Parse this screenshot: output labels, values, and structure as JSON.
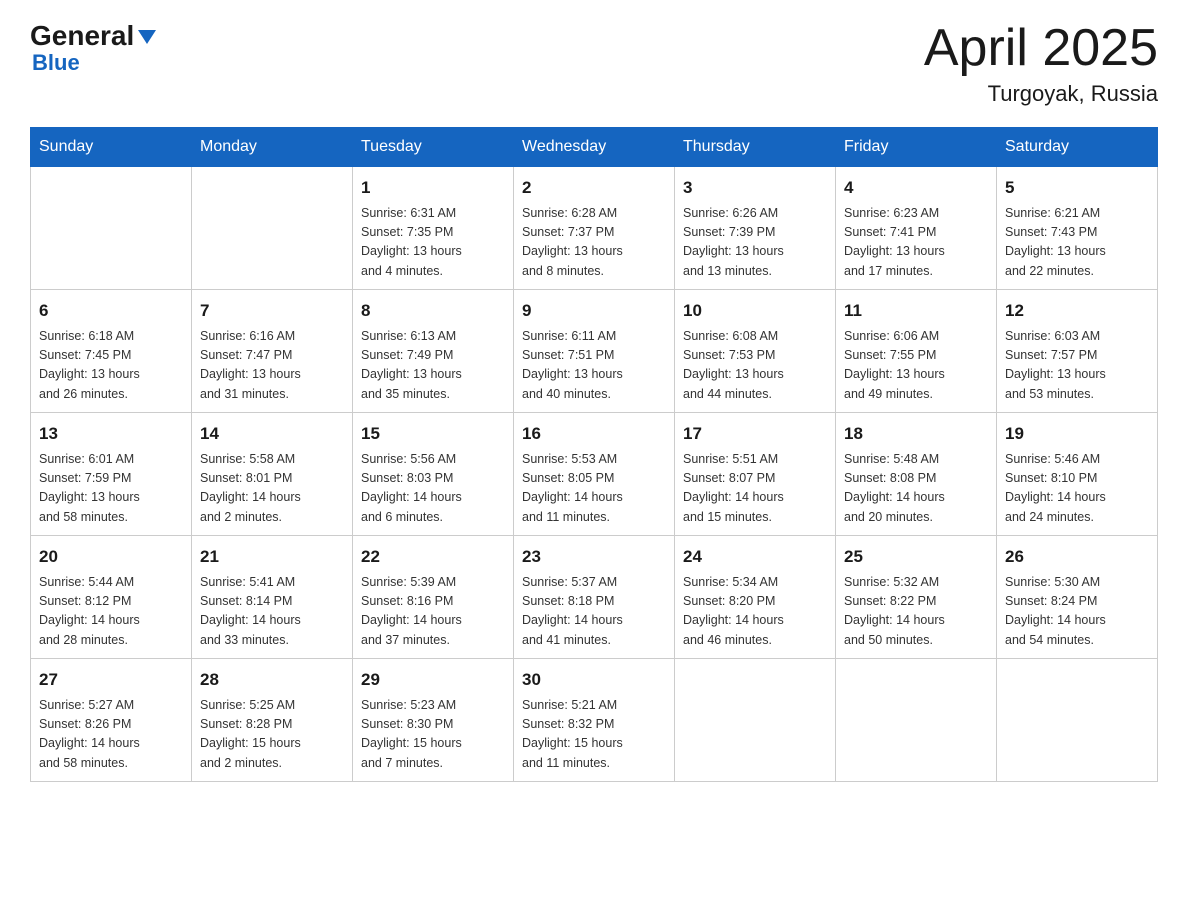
{
  "header": {
    "logo": {
      "general": "General",
      "arrow_symbol": "▶",
      "blue": "Blue"
    },
    "title": "April 2025",
    "location": "Turgoyak, Russia"
  },
  "calendar": {
    "days_of_week": [
      "Sunday",
      "Monday",
      "Tuesday",
      "Wednesday",
      "Thursday",
      "Friday",
      "Saturday"
    ],
    "weeks": [
      [
        {
          "day": "",
          "info": ""
        },
        {
          "day": "",
          "info": ""
        },
        {
          "day": "1",
          "info": "Sunrise: 6:31 AM\nSunset: 7:35 PM\nDaylight: 13 hours\nand 4 minutes."
        },
        {
          "day": "2",
          "info": "Sunrise: 6:28 AM\nSunset: 7:37 PM\nDaylight: 13 hours\nand 8 minutes."
        },
        {
          "day": "3",
          "info": "Sunrise: 6:26 AM\nSunset: 7:39 PM\nDaylight: 13 hours\nand 13 minutes."
        },
        {
          "day": "4",
          "info": "Sunrise: 6:23 AM\nSunset: 7:41 PM\nDaylight: 13 hours\nand 17 minutes."
        },
        {
          "day": "5",
          "info": "Sunrise: 6:21 AM\nSunset: 7:43 PM\nDaylight: 13 hours\nand 22 minutes."
        }
      ],
      [
        {
          "day": "6",
          "info": "Sunrise: 6:18 AM\nSunset: 7:45 PM\nDaylight: 13 hours\nand 26 minutes."
        },
        {
          "day": "7",
          "info": "Sunrise: 6:16 AM\nSunset: 7:47 PM\nDaylight: 13 hours\nand 31 minutes."
        },
        {
          "day": "8",
          "info": "Sunrise: 6:13 AM\nSunset: 7:49 PM\nDaylight: 13 hours\nand 35 minutes."
        },
        {
          "day": "9",
          "info": "Sunrise: 6:11 AM\nSunset: 7:51 PM\nDaylight: 13 hours\nand 40 minutes."
        },
        {
          "day": "10",
          "info": "Sunrise: 6:08 AM\nSunset: 7:53 PM\nDaylight: 13 hours\nand 44 minutes."
        },
        {
          "day": "11",
          "info": "Sunrise: 6:06 AM\nSunset: 7:55 PM\nDaylight: 13 hours\nand 49 minutes."
        },
        {
          "day": "12",
          "info": "Sunrise: 6:03 AM\nSunset: 7:57 PM\nDaylight: 13 hours\nand 53 minutes."
        }
      ],
      [
        {
          "day": "13",
          "info": "Sunrise: 6:01 AM\nSunset: 7:59 PM\nDaylight: 13 hours\nand 58 minutes."
        },
        {
          "day": "14",
          "info": "Sunrise: 5:58 AM\nSunset: 8:01 PM\nDaylight: 14 hours\nand 2 minutes."
        },
        {
          "day": "15",
          "info": "Sunrise: 5:56 AM\nSunset: 8:03 PM\nDaylight: 14 hours\nand 6 minutes."
        },
        {
          "day": "16",
          "info": "Sunrise: 5:53 AM\nSunset: 8:05 PM\nDaylight: 14 hours\nand 11 minutes."
        },
        {
          "day": "17",
          "info": "Sunrise: 5:51 AM\nSunset: 8:07 PM\nDaylight: 14 hours\nand 15 minutes."
        },
        {
          "day": "18",
          "info": "Sunrise: 5:48 AM\nSunset: 8:08 PM\nDaylight: 14 hours\nand 20 minutes."
        },
        {
          "day": "19",
          "info": "Sunrise: 5:46 AM\nSunset: 8:10 PM\nDaylight: 14 hours\nand 24 minutes."
        }
      ],
      [
        {
          "day": "20",
          "info": "Sunrise: 5:44 AM\nSunset: 8:12 PM\nDaylight: 14 hours\nand 28 minutes."
        },
        {
          "day": "21",
          "info": "Sunrise: 5:41 AM\nSunset: 8:14 PM\nDaylight: 14 hours\nand 33 minutes."
        },
        {
          "day": "22",
          "info": "Sunrise: 5:39 AM\nSunset: 8:16 PM\nDaylight: 14 hours\nand 37 minutes."
        },
        {
          "day": "23",
          "info": "Sunrise: 5:37 AM\nSunset: 8:18 PM\nDaylight: 14 hours\nand 41 minutes."
        },
        {
          "day": "24",
          "info": "Sunrise: 5:34 AM\nSunset: 8:20 PM\nDaylight: 14 hours\nand 46 minutes."
        },
        {
          "day": "25",
          "info": "Sunrise: 5:32 AM\nSunset: 8:22 PM\nDaylight: 14 hours\nand 50 minutes."
        },
        {
          "day": "26",
          "info": "Sunrise: 5:30 AM\nSunset: 8:24 PM\nDaylight: 14 hours\nand 54 minutes."
        }
      ],
      [
        {
          "day": "27",
          "info": "Sunrise: 5:27 AM\nSunset: 8:26 PM\nDaylight: 14 hours\nand 58 minutes."
        },
        {
          "day": "28",
          "info": "Sunrise: 5:25 AM\nSunset: 8:28 PM\nDaylight: 15 hours\nand 2 minutes."
        },
        {
          "day": "29",
          "info": "Sunrise: 5:23 AM\nSunset: 8:30 PM\nDaylight: 15 hours\nand 7 minutes."
        },
        {
          "day": "30",
          "info": "Sunrise: 5:21 AM\nSunset: 8:32 PM\nDaylight: 15 hours\nand 11 minutes."
        },
        {
          "day": "",
          "info": ""
        },
        {
          "day": "",
          "info": ""
        },
        {
          "day": "",
          "info": ""
        }
      ]
    ]
  }
}
